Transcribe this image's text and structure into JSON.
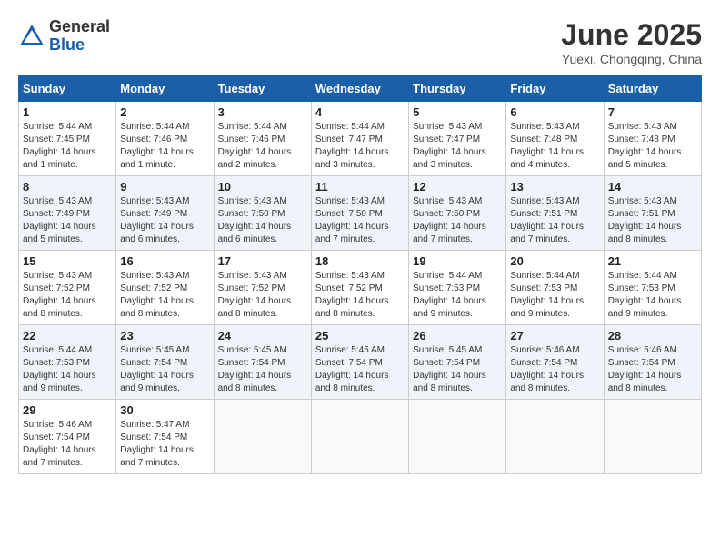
{
  "header": {
    "logo_general": "General",
    "logo_blue": "Blue",
    "month_title": "June 2025",
    "location": "Yuexi, Chongqing, China"
  },
  "calendar": {
    "days_of_week": [
      "Sunday",
      "Monday",
      "Tuesday",
      "Wednesday",
      "Thursday",
      "Friday",
      "Saturday"
    ],
    "weeks": [
      [
        {
          "day": "",
          "info": ""
        },
        {
          "day": "2",
          "info": "Sunrise: 5:44 AM\nSunset: 7:46 PM\nDaylight: 14 hours\nand 1 minute."
        },
        {
          "day": "3",
          "info": "Sunrise: 5:44 AM\nSunset: 7:46 PM\nDaylight: 14 hours\nand 2 minutes."
        },
        {
          "day": "4",
          "info": "Sunrise: 5:44 AM\nSunset: 7:47 PM\nDaylight: 14 hours\nand 3 minutes."
        },
        {
          "day": "5",
          "info": "Sunrise: 5:43 AM\nSunset: 7:47 PM\nDaylight: 14 hours\nand 3 minutes."
        },
        {
          "day": "6",
          "info": "Sunrise: 5:43 AM\nSunset: 7:48 PM\nDaylight: 14 hours\nand 4 minutes."
        },
        {
          "day": "7",
          "info": "Sunrise: 5:43 AM\nSunset: 7:48 PM\nDaylight: 14 hours\nand 5 minutes."
        }
      ],
      [
        {
          "day": "1",
          "info": "Sunrise: 5:44 AM\nSunset: 7:45 PM\nDaylight: 14 hours\nand 1 minute."
        },
        {
          "day": "9",
          "info": "Sunrise: 5:43 AM\nSunset: 7:49 PM\nDaylight: 14 hours\nand 6 minutes."
        },
        {
          "day": "10",
          "info": "Sunrise: 5:43 AM\nSunset: 7:50 PM\nDaylight: 14 hours\nand 6 minutes."
        },
        {
          "day": "11",
          "info": "Sunrise: 5:43 AM\nSunset: 7:50 PM\nDaylight: 14 hours\nand 7 minutes."
        },
        {
          "day": "12",
          "info": "Sunrise: 5:43 AM\nSunset: 7:50 PM\nDaylight: 14 hours\nand 7 minutes."
        },
        {
          "day": "13",
          "info": "Sunrise: 5:43 AM\nSunset: 7:51 PM\nDaylight: 14 hours\nand 7 minutes."
        },
        {
          "day": "14",
          "info": "Sunrise: 5:43 AM\nSunset: 7:51 PM\nDaylight: 14 hours\nand 8 minutes."
        }
      ],
      [
        {
          "day": "8",
          "info": "Sunrise: 5:43 AM\nSunset: 7:49 PM\nDaylight: 14 hours\nand 5 minutes."
        },
        {
          "day": "16",
          "info": "Sunrise: 5:43 AM\nSunset: 7:52 PM\nDaylight: 14 hours\nand 8 minutes."
        },
        {
          "day": "17",
          "info": "Sunrise: 5:43 AM\nSunset: 7:52 PM\nDaylight: 14 hours\nand 8 minutes."
        },
        {
          "day": "18",
          "info": "Sunrise: 5:43 AM\nSunset: 7:52 PM\nDaylight: 14 hours\nand 8 minutes."
        },
        {
          "day": "19",
          "info": "Sunrise: 5:44 AM\nSunset: 7:53 PM\nDaylight: 14 hours\nand 9 minutes."
        },
        {
          "day": "20",
          "info": "Sunrise: 5:44 AM\nSunset: 7:53 PM\nDaylight: 14 hours\nand 9 minutes."
        },
        {
          "day": "21",
          "info": "Sunrise: 5:44 AM\nSunset: 7:53 PM\nDaylight: 14 hours\nand 9 minutes."
        }
      ],
      [
        {
          "day": "15",
          "info": "Sunrise: 5:43 AM\nSunset: 7:52 PM\nDaylight: 14 hours\nand 8 minutes."
        },
        {
          "day": "23",
          "info": "Sunrise: 5:45 AM\nSunset: 7:54 PM\nDaylight: 14 hours\nand 9 minutes."
        },
        {
          "day": "24",
          "info": "Sunrise: 5:45 AM\nSunset: 7:54 PM\nDaylight: 14 hours\nand 8 minutes."
        },
        {
          "day": "25",
          "info": "Sunrise: 5:45 AM\nSunset: 7:54 PM\nDaylight: 14 hours\nand 8 minutes."
        },
        {
          "day": "26",
          "info": "Sunrise: 5:45 AM\nSunset: 7:54 PM\nDaylight: 14 hours\nand 8 minutes."
        },
        {
          "day": "27",
          "info": "Sunrise: 5:46 AM\nSunset: 7:54 PM\nDaylight: 14 hours\nand 8 minutes."
        },
        {
          "day": "28",
          "info": "Sunrise: 5:46 AM\nSunset: 7:54 PM\nDaylight: 14 hours\nand 8 minutes."
        }
      ],
      [
        {
          "day": "22",
          "info": "Sunrise: 5:44 AM\nSunset: 7:53 PM\nDaylight: 14 hours\nand 9 minutes."
        },
        {
          "day": "30",
          "info": "Sunrise: 5:47 AM\nSunset: 7:54 PM\nDaylight: 14 hours\nand 7 minutes."
        },
        {
          "day": "",
          "info": ""
        },
        {
          "day": "",
          "info": ""
        },
        {
          "day": "",
          "info": ""
        },
        {
          "day": "",
          "info": ""
        },
        {
          "day": "",
          "info": ""
        }
      ],
      [
        {
          "day": "29",
          "info": "Sunrise: 5:46 AM\nSunset: 7:54 PM\nDaylight: 14 hours\nand 7 minutes."
        },
        {
          "day": "",
          "info": ""
        },
        {
          "day": "",
          "info": ""
        },
        {
          "day": "",
          "info": ""
        },
        {
          "day": "",
          "info": ""
        },
        {
          "day": "",
          "info": ""
        },
        {
          "day": "",
          "info": ""
        }
      ]
    ]
  }
}
